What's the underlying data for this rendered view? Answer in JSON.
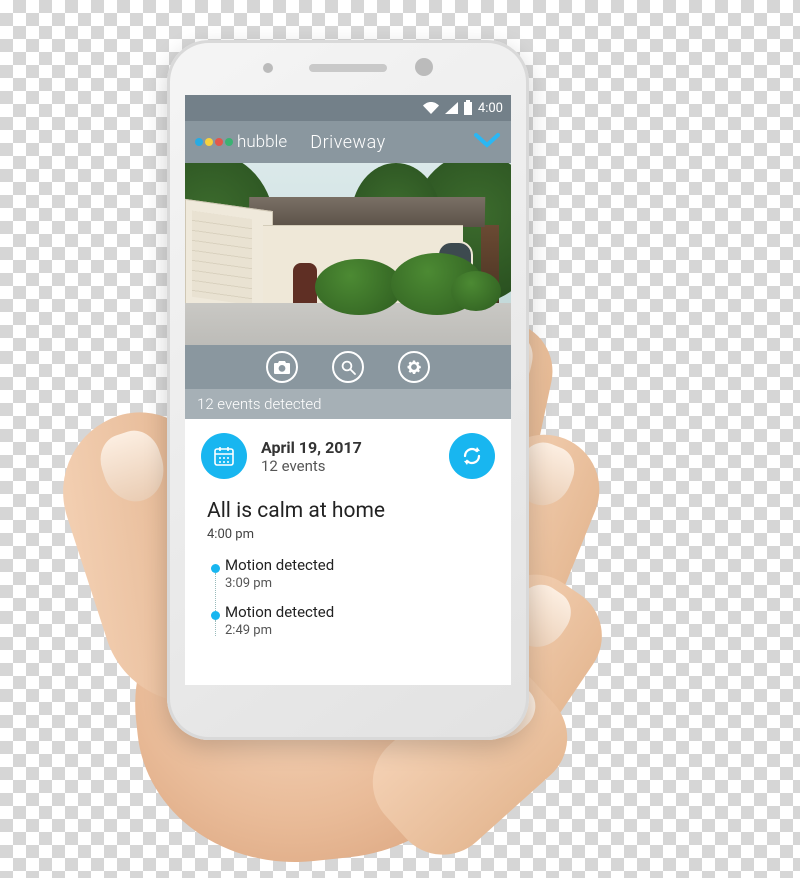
{
  "status_bar": {
    "time": "4:00"
  },
  "header": {
    "brand": "hubble",
    "title": "Driveway"
  },
  "controls": {
    "camera_icon": "camera-icon",
    "search_icon": "search-icon",
    "settings_icon": "gear-icon"
  },
  "events_banner": "12 events detected",
  "date_row": {
    "date": "April 19, 2017",
    "count": "12 events"
  },
  "feed": {
    "headline": "All is calm at home",
    "headline_time": "4:00 pm",
    "events": [
      {
        "title": "Motion detected",
        "time": "3:09 pm"
      },
      {
        "title": "Motion detected",
        "time": "2:49 pm"
      }
    ]
  },
  "colors": {
    "accent": "#18b6f0",
    "chrome": "#8a979f"
  }
}
